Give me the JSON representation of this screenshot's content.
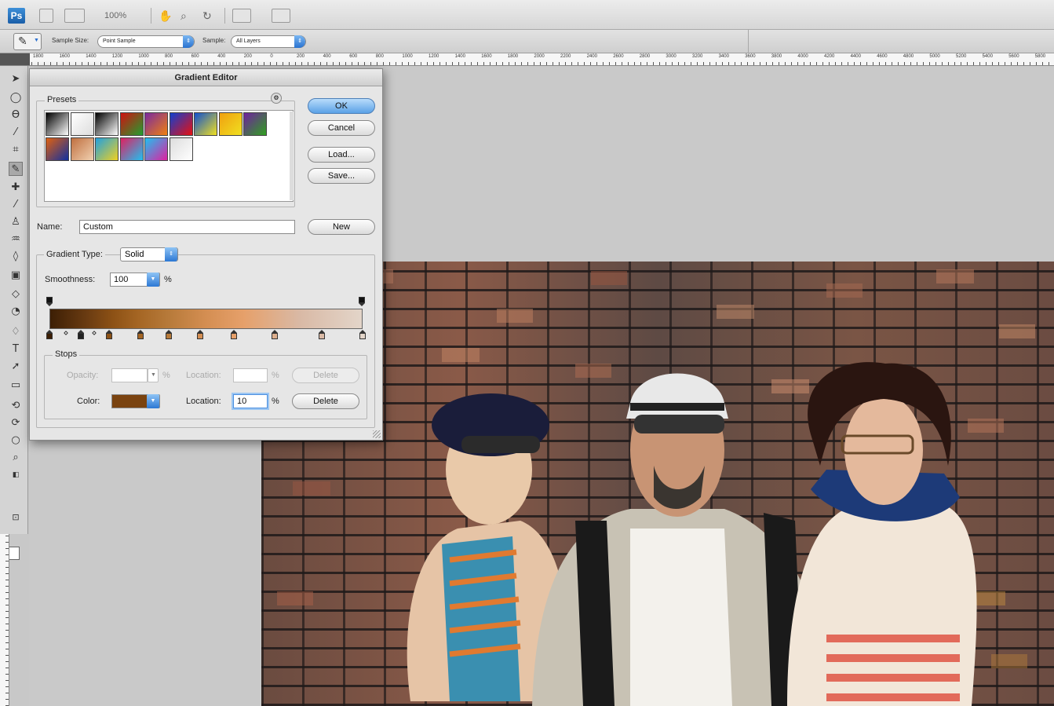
{
  "app": {
    "logo": "Ps",
    "zoom": "100%"
  },
  "options_bar": {
    "sample_size_label": "Sample Size:",
    "sample_size_value": "Point Sample",
    "sample_label": "Sample:",
    "sample_value": "All Layers"
  },
  "ruler": {
    "ticks": [
      "1800",
      "1600",
      "1400",
      "1200",
      "1000",
      "800",
      "600",
      "400",
      "200",
      "0",
      "200",
      "400",
      "600",
      "800",
      "1000",
      "1200",
      "1400",
      "1600",
      "1800",
      "2000",
      "2200",
      "2400",
      "2600",
      "2800",
      "3000",
      "3200",
      "3400",
      "3600",
      "3800",
      "4000",
      "4200",
      "4400",
      "4600",
      "4800",
      "5000",
      "5200",
      "5400",
      "5600",
      "5800"
    ]
  },
  "dialog": {
    "title": "Gradient Editor",
    "presets_label": "Presets",
    "ok_label": "OK",
    "cancel_label": "Cancel",
    "load_label": "Load...",
    "save_label": "Save...",
    "name_label": "Name:",
    "name_value": "Custom",
    "new_label": "New",
    "gradient_type_label": "Gradient Type:",
    "gradient_type_value": "Solid",
    "smoothness_label": "Smoothness:",
    "smoothness_value": "100",
    "percent": "%",
    "stops_label": "Stops",
    "opacity_label": "Opacity:",
    "opacity_value": "",
    "location_label": "Location:",
    "opacity_location_value": "",
    "delete_label": "Delete",
    "color_label": "Color:",
    "color_swatch": "#7a4310",
    "color_location_value": "10",
    "presets": [
      [
        "#000000",
        "#ffffff"
      ],
      [
        "#ffffff",
        "#dddddd"
      ],
      [
        "#000000",
        "#ffffff"
      ],
      [
        "#d01010",
        "#20a030"
      ],
      [
        "#7a2aa0",
        "#f08010"
      ],
      [
        "#1040d0",
        "#e81010"
      ],
      [
        "#1050d0",
        "#f0e020"
      ],
      [
        "#f0a010",
        "#f0e020"
      ],
      [
        "#7020a0",
        "#30a020"
      ],
      [
        "#e06010",
        "#1030a0"
      ],
      [
        "#c07040",
        "#f0d0b0"
      ],
      [
        "#20a0e0",
        "#f0d020"
      ],
      [
        "#e02060",
        "#20c0f0"
      ],
      [
        "#20c0f0",
        "#e020a0"
      ],
      [
        "#dddddd",
        "#ffffff"
      ]
    ],
    "color_stops": [
      {
        "pos": 0,
        "color": "#3d1f05"
      },
      {
        "pos": 10,
        "color": "#7a4310"
      },
      {
        "pos": 19,
        "color": "#8c5115"
      },
      {
        "pos": 29,
        "color": "#a46523"
      },
      {
        "pos": 38,
        "color": "#b77a3a"
      },
      {
        "pos": 48,
        "color": "#d48e52"
      },
      {
        "pos": 59,
        "color": "#e6a06a"
      },
      {
        "pos": 72,
        "color": "#dcae8c"
      },
      {
        "pos": 87,
        "color": "#d9b9a5"
      },
      {
        "pos": 100,
        "color": "#e3d5c9"
      }
    ]
  }
}
